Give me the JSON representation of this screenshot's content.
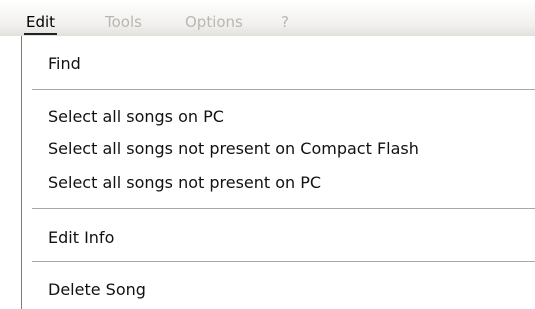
{
  "menubar": {
    "items": [
      {
        "label": "Edit",
        "state": "active"
      },
      {
        "label": "Tools",
        "state": "disabled"
      },
      {
        "label": "Options",
        "state": "disabled"
      },
      {
        "label": "?",
        "state": "disabled"
      }
    ]
  },
  "edit_menu": {
    "groups": [
      {
        "items": [
          {
            "label": "Find"
          }
        ]
      },
      {
        "items": [
          {
            "label": "Select all songs on PC"
          },
          {
            "label": "Select all songs not present on Compact Flash"
          },
          {
            "label": "Select all songs not present on PC"
          }
        ]
      },
      {
        "items": [
          {
            "label": "Edit Info"
          }
        ]
      },
      {
        "items": [
          {
            "label": "Delete Song"
          }
        ]
      }
    ]
  },
  "colors": {
    "menubar_gradient_top": "#ffffff",
    "menubar_gradient_bottom": "#e4e2dd",
    "disabled_text": "#b8b7b2",
    "separator": "#aaa8a0",
    "menu_border": "#7d7b74"
  }
}
